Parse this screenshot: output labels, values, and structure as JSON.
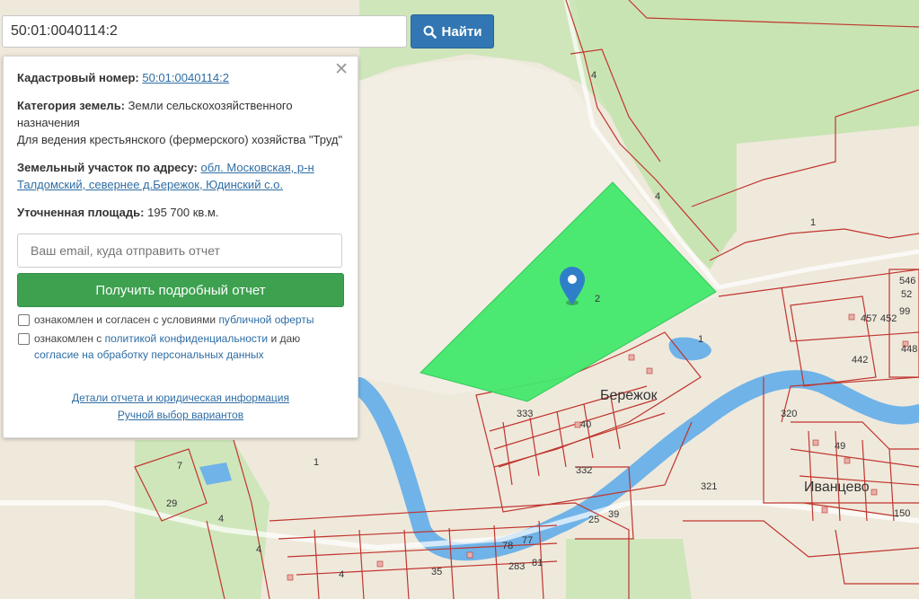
{
  "search": {
    "value": "50:01:0040114:2",
    "button_label": "Найти",
    "button_icon": "search-icon"
  },
  "info": {
    "cadastral_label": "Кадастровый номер:",
    "cadastral_value": "50:01:0040114:2",
    "category_label": "Категория земель:",
    "category_value": "Земли сельскохозяйственного назначения",
    "usage_value": "Для ведения крестьянского (фермерского) хозяйства \"Труд\"",
    "address_label": "Земельный участок по адресу:",
    "address_value": "обл. Московская, р-н Талдомский, севернее д.Бережок, Юдинский с.о.",
    "area_label": "Уточненная площадь:",
    "area_value": "195 700 кв.м.",
    "close_icon": "close-icon"
  },
  "report": {
    "email_placeholder": "Ваш email, куда отправить отчет",
    "button_label": "Получить подробный отчет",
    "check1_text": "ознакомлен и согласен с условиями ",
    "check1_link": "публичной оферты",
    "check2_text": "ознакомлен с ",
    "check2_link": "политикой конфиденциальности",
    "check2_mid": " и даю ",
    "check2_link2": "согласие на обработку персональных данных",
    "details_link": "Детали отчета и юридическая информация",
    "manual_link": "Ручной выбор вариантов"
  },
  "map": {
    "village_1": "Бережок",
    "village_2": "Иванцево",
    "selected_parcel_label": "2",
    "parcel_labels": [
      "4",
      "4",
      "1",
      "1",
      "333",
      "40",
      "332",
      "320",
      "321",
      "1",
      "29",
      "4",
      "4",
      "25",
      "39",
      "78",
      "77",
      "283",
      "81",
      "35",
      "4",
      "546",
      "52",
      "457",
      "452",
      "99",
      "448",
      "442",
      "49",
      "150",
      "7"
    ],
    "colors": {
      "selected_parcel": "#42e86b",
      "river": "#6fb3e8",
      "forest": "#cfe6bb",
      "field": "#efe9dc",
      "boundary": "#c0352e",
      "marker": "#2f7fc8"
    }
  }
}
